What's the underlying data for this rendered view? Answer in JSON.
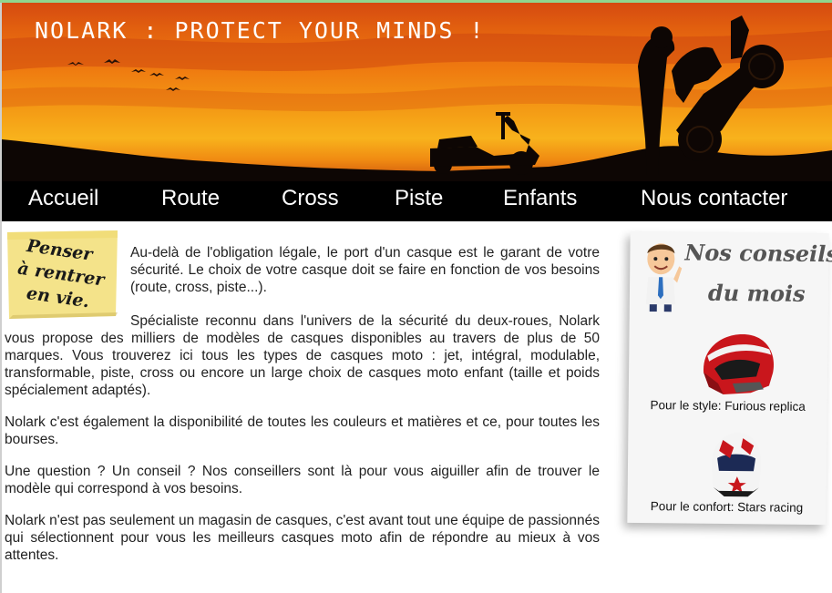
{
  "header": {
    "title": "NOLARK : PROTECT YOUR MINDS !"
  },
  "nav": {
    "items": [
      {
        "label": "Accueil"
      },
      {
        "label": "Route"
      },
      {
        "label": "Cross"
      },
      {
        "label": "Piste"
      },
      {
        "label": "Enfants"
      },
      {
        "label": "Nous contacter"
      }
    ]
  },
  "note": {
    "lines": [
      "Penser",
      "à rentrer",
      "en vie."
    ]
  },
  "main": {
    "paragraphs": [
      "Au-delà de l'obligation légale, le port d'un casque est le garant de votre sécurité. Le choix de votre casque doit se faire en fonction de vos besoins (route, cross, piste...).",
      "Spécialiste reconnu dans l'univers de la sécurité du deux-roues, Nolark vous propose des milliers de modèles de casques disponibles au travers de plus de 50 marques. Vous trouverez ici tous les types de casques moto : jet, intégral, modulable, transformable, piste, cross ou encore un large choix de casques moto enfant (taille et poids spécialement adaptés).",
      "Nolark c'est également la disponibilité de toutes les couleurs et matières et ce, pour toutes les bourses.",
      "Une question ? Un conseil ? Nos conseillers sont là pour vous aiguiller afin de trouver le modèle qui correspond à vos besoins.",
      "Nolark n'est pas seulement un magasin de casques, c'est avant tout une équipe de passionnés qui sélectionnent pour vous les meilleurs casques moto afin de répondre au mieux à vos attentes."
    ]
  },
  "sidebar": {
    "title_line1": "Nos conseils",
    "title_line2": "du mois",
    "products": [
      {
        "caption": "Pour le style: Furious replica"
      },
      {
        "caption": "Pour le confort: Stars racing"
      }
    ]
  },
  "colors": {
    "nav_bg": "#000000",
    "nav_text": "#ffffff",
    "sunset_orange": "#f08a12"
  }
}
